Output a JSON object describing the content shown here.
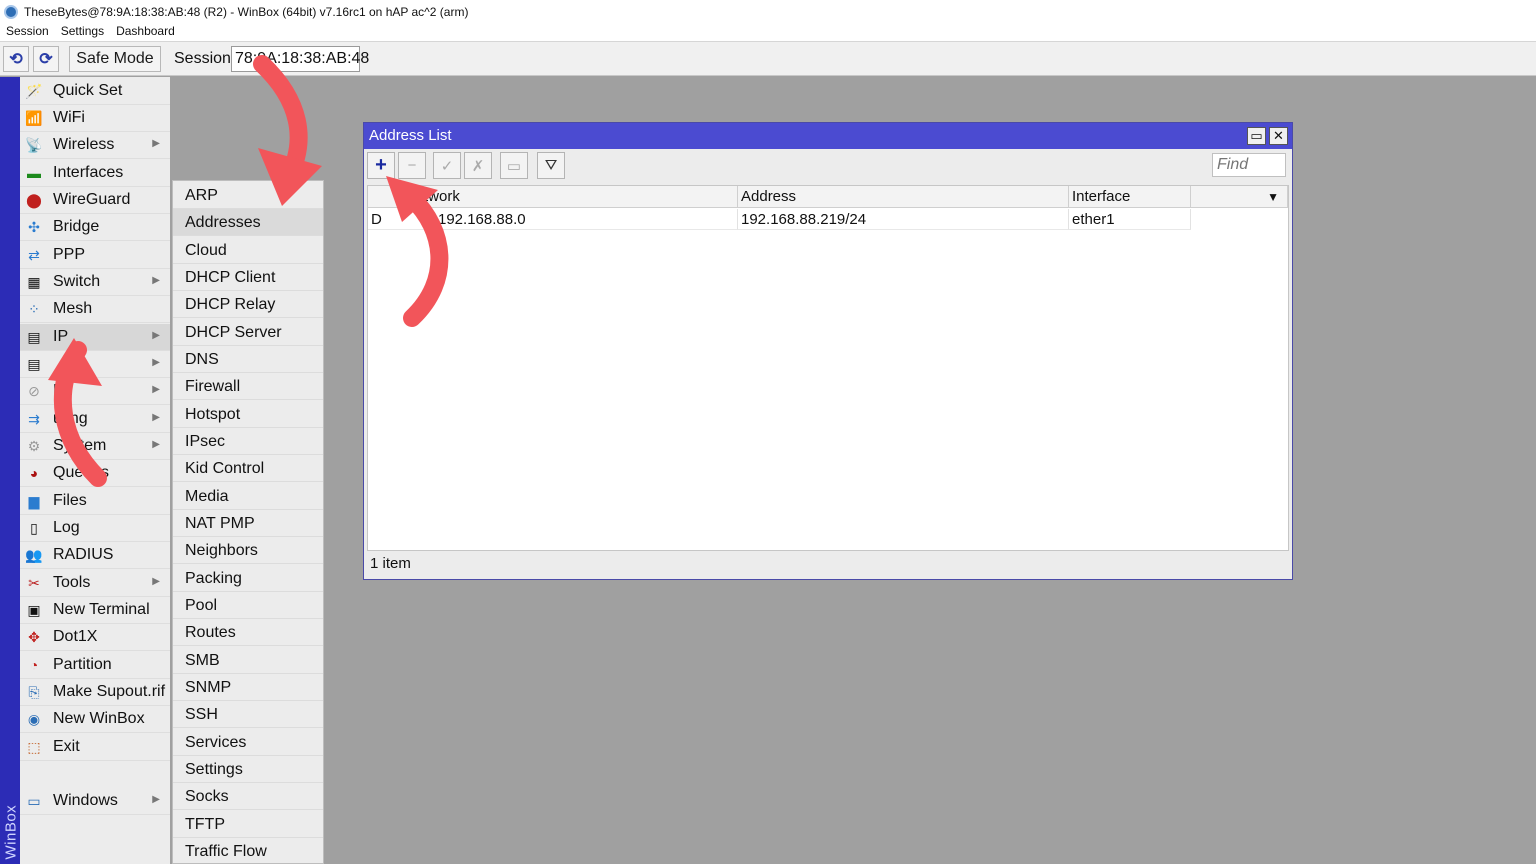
{
  "window_title": "TheseBytes@78:9A:18:38:AB:48 (R2) - WinBox (64bit) v7.16rc1 on hAP ac^2 (arm)",
  "menubar": [
    "Session",
    "Settings",
    "Dashboard"
  ],
  "toolbar": {
    "undo_icon": "undo-icon",
    "redo_icon": "redo-icon",
    "safe_mode": "Safe Mode",
    "session_label": "Session:",
    "session_value": "78:9A:18:38:AB:48"
  },
  "brand": "WinBox",
  "left_menu": [
    {
      "label": "Quick Set",
      "icon": "wand-icon",
      "arrow": false
    },
    {
      "label": "WiFi",
      "icon": "wifi-icon",
      "arrow": false
    },
    {
      "label": "Wireless",
      "icon": "wireless-icon",
      "arrow": true
    },
    {
      "label": "Interfaces",
      "icon": "interfaces-icon",
      "arrow": false
    },
    {
      "label": "WireGuard",
      "icon": "wireguard-icon",
      "arrow": false
    },
    {
      "label": "Bridge",
      "icon": "bridge-icon",
      "arrow": false
    },
    {
      "label": "PPP",
      "icon": "ppp-icon",
      "arrow": false
    },
    {
      "label": "Switch",
      "icon": "switch-icon",
      "arrow": true
    },
    {
      "label": "Mesh",
      "icon": "mesh-icon",
      "arrow": false
    },
    {
      "label": "IP",
      "icon": "ip-icon",
      "arrow": true
    },
    {
      "label": "",
      "icon": "ipv6-icon",
      "arrow": true
    },
    {
      "label": "PL",
      "icon": "mpls-icon",
      "arrow": true
    },
    {
      "label": "uting",
      "icon": "routing-icon",
      "arrow": true
    },
    {
      "label": "System",
      "icon": "system-icon",
      "arrow": true
    },
    {
      "label": "Queues",
      "icon": "queues-icon",
      "arrow": false
    },
    {
      "label": "Files",
      "icon": "files-icon",
      "arrow": false
    },
    {
      "label": "Log",
      "icon": "log-icon",
      "arrow": false
    },
    {
      "label": "RADIUS",
      "icon": "radius-icon",
      "arrow": false
    },
    {
      "label": "Tools",
      "icon": "tools-icon",
      "arrow": true
    },
    {
      "label": "New Terminal",
      "icon": "terminal-icon",
      "arrow": false
    },
    {
      "label": "Dot1X",
      "icon": "dot1x-icon",
      "arrow": false
    },
    {
      "label": "Partition",
      "icon": "partition-icon",
      "arrow": false
    },
    {
      "label": "Make Supout.rif",
      "icon": "supout-icon",
      "arrow": false
    },
    {
      "label": "New WinBox",
      "icon": "winbox-icon",
      "arrow": false
    },
    {
      "label": "Exit",
      "icon": "exit-icon",
      "arrow": false
    },
    {
      "label": "Windows",
      "icon": "windows-icon",
      "arrow": true
    }
  ],
  "ip_submenu": [
    "ARP",
    "Addresses",
    "Cloud",
    "DHCP Client",
    "DHCP Relay",
    "DHCP Server",
    "DNS",
    "Firewall",
    "Hotspot",
    "IPsec",
    "Kid Control",
    "Media",
    "NAT PMP",
    "Neighbors",
    "Packing",
    "Pool",
    "Routes",
    "SMB",
    "SNMP",
    "SSH",
    "Services",
    "Settings",
    "Socks",
    "TFTP",
    "Traffic Flow"
  ],
  "address_window": {
    "title": "Address List",
    "find_placeholder": "Find",
    "columns": [
      "twork",
      "Address",
      "Interface"
    ],
    "rows": [
      {
        "flag": "D",
        "network": "192.168.88.0",
        "address": "192.168.88.219/24",
        "interface": "ether1"
      }
    ],
    "status": "1 item"
  },
  "colors": {
    "accent": "#4b4bd1",
    "brand_strip": "#2c2cb6",
    "annotation": "#f2555a"
  }
}
